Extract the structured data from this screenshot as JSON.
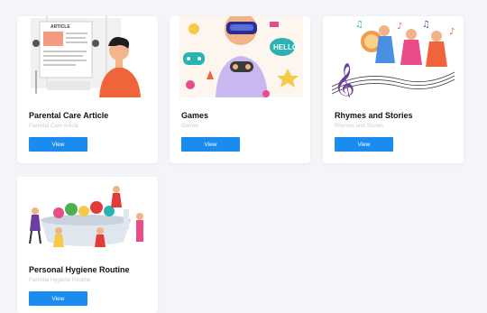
{
  "cards": [
    {
      "title": "Parental Care Article",
      "subtitle": "Parental Care Article",
      "button": "View",
      "image": "article-illustration"
    },
    {
      "title": "Games",
      "subtitle": "Games",
      "button": "View",
      "image": "gamer-illustration"
    },
    {
      "title": "Rhymes and Stories",
      "subtitle": "Rhymes and Stories",
      "button": "View",
      "image": "music-kids-illustration"
    },
    {
      "title": "Personal Hygiene Routine",
      "subtitle": "Parental Hygiene Routine",
      "button": "View",
      "image": "handwashing-illustration"
    }
  ],
  "colors": {
    "accent": "#1a8cf0",
    "background": "#f3f5f8"
  }
}
